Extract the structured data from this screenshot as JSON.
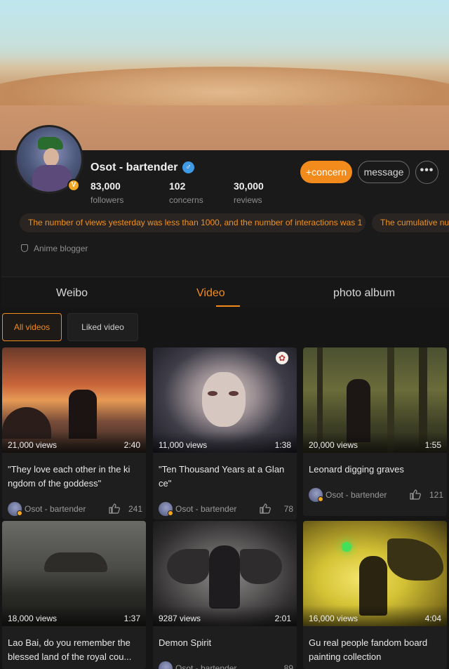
{
  "profile": {
    "name": "Osot - bartender",
    "verified_badge": "V",
    "gender_icon": "male-icon",
    "stats": [
      {
        "value": "83,000",
        "label": "followers"
      },
      {
        "value": "102",
        "label": "concerns"
      },
      {
        "value": "30,000",
        "label": "reviews"
      }
    ],
    "buttons": {
      "concern": "+concern",
      "message": "message",
      "more": "•••"
    },
    "notices": [
      "The number of views yesterday was less than 1000, and the number of interactions was 1",
      "The cumulative nur"
    ],
    "tag": "Anime blogger",
    "accent_color": "#f28a1c"
  },
  "tabs": [
    {
      "label": "Weibo",
      "active": false
    },
    {
      "label": "Video",
      "active": true
    },
    {
      "label": "photo album",
      "active": false
    }
  ],
  "filters": {
    "all": "All videos",
    "liked": "Liked video"
  },
  "videos": [
    {
      "views": "21,000 views",
      "duration": "2:40",
      "title": "\"They love each other in the ki ngdom of the goddess\"",
      "author": "Osot - bartender",
      "likes": "241"
    },
    {
      "views": "11,000 views",
      "duration": "1:38",
      "title": "\"Ten Thousand Years at a Glan ce\"",
      "author": "Osot - bartender",
      "likes": "78"
    },
    {
      "views": "20,000 views",
      "duration": "1:55",
      "title": "Leonard digging graves",
      "author": "Osot - bartender",
      "likes": "121"
    },
    {
      "views": "18,000 views",
      "duration": "1:37",
      "title": "Lao Bai, do you remember the blessed land of the royal cou...",
      "author": "",
      "likes": ""
    },
    {
      "views": "9287 views",
      "duration": "2:01",
      "title": "Demon Spirit",
      "author": "Osot - bartender",
      "likes": "89"
    },
    {
      "views": "16,000 views",
      "duration": "4:04",
      "title": "Gu real people fandom board painting collection",
      "author": "",
      "likes": ""
    }
  ]
}
